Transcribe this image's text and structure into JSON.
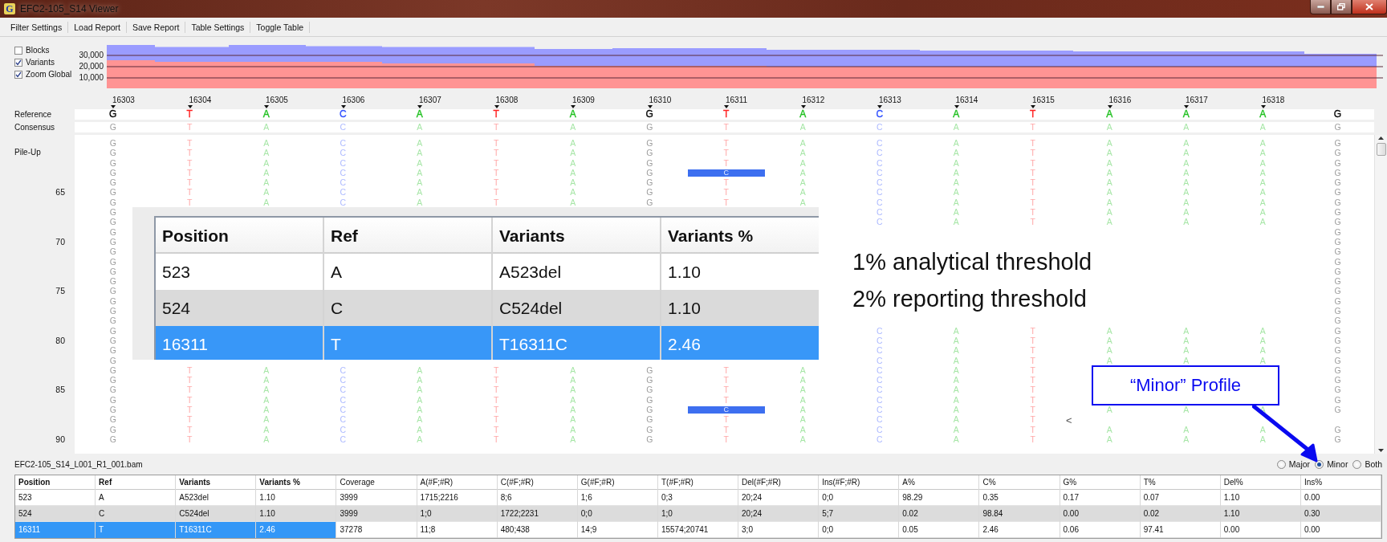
{
  "window": {
    "icon_letter": "G",
    "title": "EFC2-105_S14 Viewer"
  },
  "menu": [
    "Filter Settings",
    "Load Report",
    "Save Report",
    "Table Settings",
    "Toggle Table"
  ],
  "coverage": {
    "toggles": [
      {
        "label": "Blocks",
        "checked": false
      },
      {
        "label": "Variants",
        "checked": true
      },
      {
        "label": "Zoom Global",
        "checked": true
      }
    ],
    "axis_labels": [
      "30,000",
      "20,000",
      "10,000"
    ]
  },
  "ruler": [
    "16303",
    "16304",
    "16305",
    "16306",
    "16307",
    "16308",
    "16309",
    "16310",
    "16311",
    "16312",
    "16313",
    "16314",
    "16315",
    "16316",
    "16317",
    "16318"
  ],
  "reference": {
    "label": "Reference",
    "bases": [
      {
        "base": "G",
        "color": "#000000"
      },
      {
        "base": "T",
        "color": "#ff2020"
      },
      {
        "base": "A",
        "color": "#20c020"
      },
      {
        "base": "C",
        "color": "#3050ff"
      },
      {
        "base": "A",
        "color": "#20c020"
      },
      {
        "base": "T",
        "color": "#ff2020"
      },
      {
        "base": "A",
        "color": "#20c020"
      },
      {
        "base": "G",
        "color": "#000000"
      },
      {
        "base": "T",
        "color": "#ff2020"
      },
      {
        "base": "A",
        "color": "#20c020"
      },
      {
        "base": "C",
        "color": "#3050ff"
      },
      {
        "base": "A",
        "color": "#20c020"
      },
      {
        "base": "T",
        "color": "#ff2020"
      },
      {
        "base": "A",
        "color": "#20c020"
      },
      {
        "base": "A",
        "color": "#20c020"
      },
      {
        "base": "A",
        "color": "#20c020"
      },
      {
        "base": "G",
        "color": "#000000"
      }
    ]
  },
  "consensus": {
    "label": "Consensus",
    "bases": [
      "G",
      "T",
      "A",
      "C",
      "A",
      "T",
      "A",
      "G",
      "T",
      "A",
      "C",
      "A",
      "T",
      "A",
      "A",
      "A",
      "G"
    ]
  },
  "pileup": {
    "title": "Pile-Up",
    "marker": "<",
    "rows": [
      {
        "kind": "plain",
        "cells": [
          "G",
          "T",
          "A",
          "C",
          "A",
          "T",
          "A",
          "G",
          "T",
          "A",
          "C",
          "A",
          "T",
          "A",
          "A",
          "A",
          "G"
        ]
      },
      {
        "kind": "plain",
        "cells": [
          "G",
          "T",
          "A",
          "C",
          "A",
          "T",
          "A",
          "G",
          "T",
          "A",
          "C",
          "A",
          "T",
          "A",
          "A",
          "A",
          "G"
        ]
      },
      {
        "kind": "plain",
        "cells": [
          "G",
          "T",
          "A",
          "C",
          "A",
          "T",
          "A",
          "G",
          "T",
          "A",
          "C",
          "A",
          "T",
          "A",
          "A",
          "A",
          "G"
        ]
      },
      {
        "kind": "variant",
        "cells_before": [
          "G",
          "T",
          "A",
          "C",
          "A",
          "T",
          "A",
          "G"
        ],
        "variant": "C",
        "cells_after": [
          "A",
          "C",
          "A",
          "T",
          "A",
          "A",
          "A",
          "G"
        ]
      },
      {
        "kind": "plain",
        "cells": [
          "G",
          "T",
          "A",
          "C",
          "A",
          "T",
          "A",
          "G",
          "T",
          "A",
          "C",
          "A",
          "T",
          "A",
          "A",
          "A",
          "G"
        ]
      },
      {
        "kind": "plain",
        "label": "65",
        "cells": [
          "G",
          "T",
          "A",
          "C",
          "A",
          "T",
          "A",
          "G",
          "T",
          "A",
          "C",
          "A",
          "T",
          "A",
          "A",
          "A",
          "G"
        ]
      },
      {
        "kind": "plain",
        "cells": [
          "G",
          "T",
          "A",
          "C",
          "A",
          "T",
          "A",
          "G",
          "T",
          "A",
          "C",
          "A",
          "T",
          "A",
          "A",
          "A",
          "G"
        ]
      },
      {
        "kind": "plain",
        "cells": [
          "G",
          null,
          null,
          null,
          null,
          null,
          null,
          null,
          null,
          null,
          "C",
          "A",
          "T",
          "A",
          "A",
          "A",
          "G"
        ]
      },
      {
        "kind": "plain",
        "cells": [
          "G",
          null,
          null,
          null,
          null,
          null,
          null,
          null,
          null,
          null,
          "C",
          "A",
          "T",
          "A",
          "A",
          "A",
          "G"
        ]
      },
      {
        "kind": "plain",
        "cells": [
          "G",
          null,
          null,
          null,
          null,
          null,
          null,
          null,
          null,
          null,
          null,
          null,
          null,
          null,
          null,
          null,
          "G"
        ]
      },
      {
        "kind": "plain",
        "label": "70",
        "cells": [
          "G",
          null,
          null,
          null,
          null,
          null,
          null,
          null,
          null,
          null,
          null,
          null,
          null,
          null,
          null,
          null,
          "G"
        ]
      },
      {
        "kind": "plain",
        "cells": [
          "G",
          null,
          null,
          null,
          null,
          null,
          null,
          null,
          null,
          null,
          null,
          null,
          null,
          null,
          null,
          null,
          "G"
        ]
      },
      {
        "kind": "plain",
        "cells": [
          "G",
          null,
          null,
          null,
          null,
          null,
          null,
          null,
          null,
          null,
          null,
          null,
          null,
          null,
          null,
          null,
          "G"
        ]
      },
      {
        "kind": "plain",
        "cells": [
          "G",
          null,
          null,
          null,
          null,
          null,
          null,
          null,
          null,
          null,
          null,
          null,
          null,
          null,
          null,
          null,
          "G"
        ]
      },
      {
        "kind": "plain",
        "cells": [
          "G",
          null,
          null,
          null,
          null,
          null,
          null,
          null,
          null,
          null,
          null,
          null,
          null,
          null,
          null,
          null,
          "G"
        ]
      },
      {
        "kind": "plain",
        "label": "75",
        "cells": [
          "G",
          null,
          null,
          null,
          null,
          null,
          null,
          null,
          null,
          null,
          null,
          null,
          null,
          null,
          null,
          null,
          "G"
        ]
      },
      {
        "kind": "plain",
        "cells": [
          "G",
          null,
          null,
          null,
          null,
          null,
          null,
          null,
          null,
          null,
          null,
          null,
          null,
          null,
          null,
          null,
          "G"
        ]
      },
      {
        "kind": "plain",
        "cells": [
          "G",
          null,
          null,
          null,
          null,
          null,
          null,
          null,
          null,
          null,
          null,
          null,
          null,
          null,
          null,
          null,
          "G"
        ]
      },
      {
        "kind": "plain",
        "cells": [
          "G",
          null,
          null,
          null,
          null,
          null,
          null,
          null,
          null,
          null,
          null,
          null,
          null,
          null,
          null,
          null,
          "G"
        ]
      },
      {
        "kind": "plain",
        "cells": [
          "G",
          null,
          null,
          null,
          null,
          null,
          null,
          null,
          null,
          null,
          "C",
          "A",
          "T",
          "A",
          "A",
          "A",
          "G"
        ]
      },
      {
        "kind": "plain",
        "label": "80",
        "cells": [
          "G",
          null,
          null,
          null,
          null,
          null,
          null,
          null,
          null,
          null,
          "C",
          "A",
          "T",
          "A",
          "A",
          "A",
          "G"
        ]
      },
      {
        "kind": "plain",
        "cells": [
          "G",
          null,
          null,
          null,
          null,
          null,
          null,
          null,
          null,
          null,
          "C",
          "A",
          "T",
          "A",
          "A",
          "A",
          "G"
        ]
      },
      {
        "kind": "plain",
        "cells": [
          "G",
          null,
          null,
          null,
          null,
          null,
          null,
          null,
          null,
          null,
          "C",
          "A",
          "T",
          "A",
          "A",
          "A",
          "G"
        ]
      },
      {
        "kind": "plain",
        "cells": [
          "G",
          "T",
          "A",
          "C",
          "A",
          "T",
          "A",
          "G",
          "T",
          "A",
          "C",
          "A",
          "T",
          null,
          null,
          null,
          "G"
        ]
      },
      {
        "kind": "plain",
        "cells": [
          "G",
          "T",
          "A",
          "C",
          "A",
          "T",
          "A",
          "G",
          "T",
          "A",
          "C",
          "A",
          "T",
          null,
          null,
          null,
          "G"
        ]
      },
      {
        "kind": "plain",
        "label": "85",
        "cells": [
          "G",
          "T",
          "A",
          "C",
          "A",
          "T",
          "A",
          "G",
          "T",
          "A",
          "C",
          "A",
          "T",
          null,
          null,
          null,
          "G"
        ]
      },
      {
        "kind": "plain",
        "cells": [
          "G",
          "T",
          "A",
          "C",
          "A",
          "T",
          "A",
          "G",
          "T",
          "A",
          "C",
          "A",
          "T",
          null,
          null,
          null,
          "G"
        ]
      },
      {
        "kind": "variant",
        "cells_before": [
          "G",
          "T",
          "A",
          "C",
          "A",
          "T",
          "A",
          "G"
        ],
        "variant": "C",
        "cells_after": [
          "A",
          "C",
          "A",
          "T",
          "A",
          "A",
          "A",
          "G"
        ]
      },
      {
        "kind": "plain",
        "cells": [
          "G",
          "T",
          "A",
          "C",
          "A",
          "T",
          "A",
          "G",
          "T",
          "A",
          "C",
          "A",
          "T",
          null,
          null,
          null,
          null
        ]
      },
      {
        "kind": "plain",
        "cells": [
          "G",
          "T",
          "A",
          "C",
          "A",
          "T",
          "A",
          "G",
          "T",
          "A",
          "C",
          "A",
          "T",
          "A",
          "A",
          "A",
          "G"
        ]
      },
      {
        "kind": "plain",
        "label": "90",
        "cells": [
          "G",
          "T",
          "A",
          "C",
          "A",
          "T",
          "A",
          "G",
          "T",
          "A",
          "C",
          "A",
          "T",
          "A",
          "A",
          "A",
          "G"
        ]
      }
    ]
  },
  "file_name": "EFC2-105_S14_L001_R1_001.bam",
  "profile_options": [
    {
      "label": "Major",
      "selected": false
    },
    {
      "label": "Minor",
      "selected": true
    },
    {
      "label": "Both",
      "selected": false
    }
  ],
  "variant_table": {
    "columns": [
      {
        "label": "Position",
        "key_column": true
      },
      {
        "label": "Ref",
        "key_column": true
      },
      {
        "label": "Variants",
        "key_column": true
      },
      {
        "label": "Variants %",
        "key_column": true
      },
      {
        "label": "Coverage",
        "key_column": false
      },
      {
        "label": "A(#F;#R)",
        "key_column": false
      },
      {
        "label": "C(#F;#R)",
        "key_column": false
      },
      {
        "label": "G(#F;#R)",
        "key_column": false
      },
      {
        "label": "T(#F;#R)",
        "key_column": false
      },
      {
        "label": "Del(#F;#R)",
        "key_column": false
      },
      {
        "label": "Ins(#F;#R)",
        "key_column": false
      },
      {
        "label": "A%",
        "key_column": false
      },
      {
        "label": "C%",
        "key_column": false
      },
      {
        "label": "G%",
        "key_column": false
      },
      {
        "label": "T%",
        "key_column": false
      },
      {
        "label": "Del%",
        "key_column": false
      },
      {
        "label": "Ins%",
        "key_column": false
      }
    ],
    "rows": [
      {
        "selected": false,
        "cells": [
          "523",
          "A",
          "A523del",
          "1.10",
          "3999",
          "1715;2216",
          "8;6",
          "1;6",
          "0;3",
          "20;24",
          "0;0",
          "98.29",
          "0.35",
          "0.17",
          "0.07",
          "1.10",
          "0.00"
        ]
      },
      {
        "selected": false,
        "cells": [
          "524",
          "C",
          "C524del",
          "1.10",
          "3999",
          "1;0",
          "1722;2231",
          "0;0",
          "1;0",
          "20;24",
          "5;7",
          "0.02",
          "98.84",
          "0.00",
          "0.02",
          "1.10",
          "0.30"
        ]
      },
      {
        "selected": true,
        "cells": [
          "16311",
          "T",
          "T16311C",
          "2.46",
          "37278",
          "11;8",
          "480;438",
          "14;9",
          "15574;20741",
          "3;0",
          "0;0",
          "0.05",
          "2.46",
          "0.06",
          "97.41",
          "0.00",
          "0.00"
        ]
      }
    ]
  },
  "zoomed_table": {
    "columns": [
      "Position",
      "Ref",
      "Variants",
      "Variants %"
    ],
    "rows": [
      {
        "selected": false,
        "cells": [
          "523",
          "A",
          "A523del",
          "1.10"
        ]
      },
      {
        "selected": false,
        "cells": [
          "524",
          "C",
          "C524del",
          "1.10"
        ]
      },
      {
        "selected": true,
        "cells": [
          "16311",
          "T",
          "T16311C",
          "2.46"
        ]
      }
    ]
  },
  "annotations": {
    "thresholds": [
      "1% analytical threshold",
      "2% reporting threshold"
    ],
    "callout": "“Minor” Profile"
  }
}
